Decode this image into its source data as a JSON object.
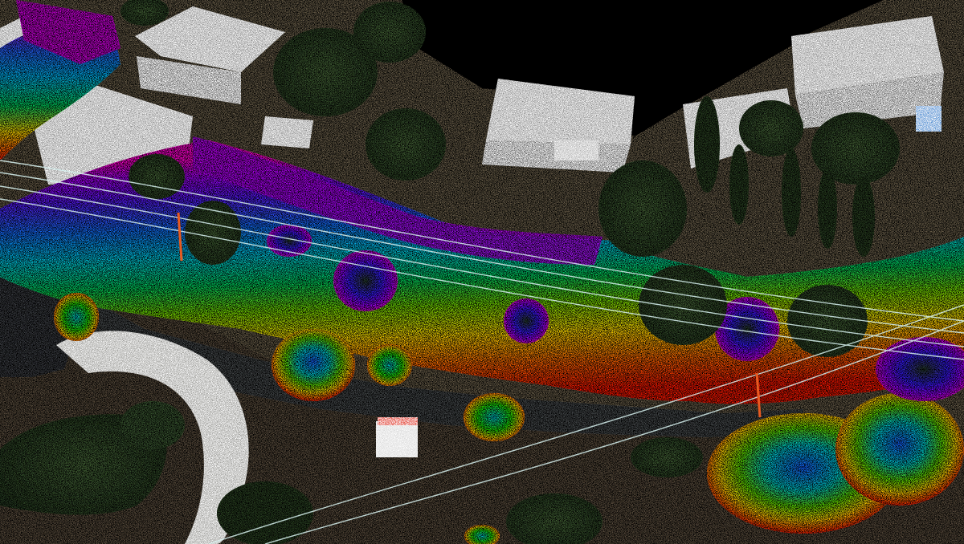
{
  "scene": {
    "kind": "lidar-point-cloud-aerial",
    "colors": {
      "void": "#000000",
      "ground": "#6b5e4c",
      "ground_dark": "#4e4438",
      "road": "#4a4d50",
      "driveway": "#9a9a96",
      "roof": "#8c8c8c",
      "roof_dark": "#5a5a5a",
      "vegetation": "#3d5a34",
      "vegetation_dark": "#2a3f25",
      "powerline": "#d8f2f0",
      "elevation_ramp": [
        "#ff1a00",
        "#ff7a00",
        "#ffd800",
        "#7ddc00",
        "#00d060",
        "#00c8e0",
        "#1a70ff",
        "#3a20ff",
        "#a000ff",
        "#ff00d0"
      ]
    }
  }
}
